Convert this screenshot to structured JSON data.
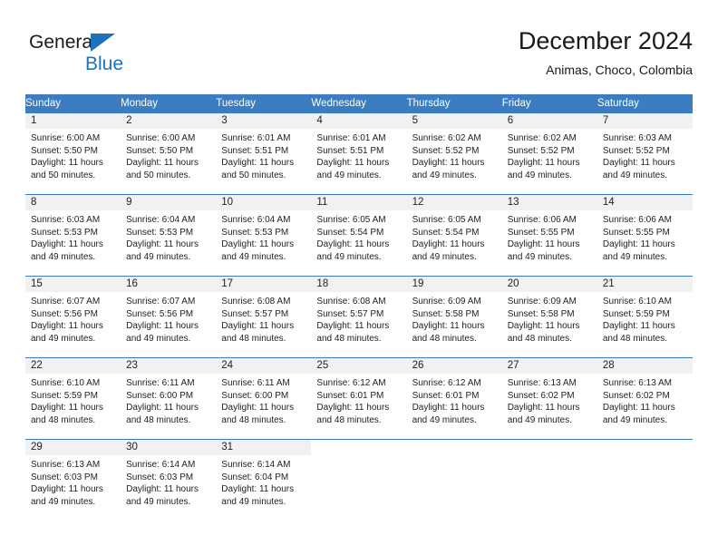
{
  "brand": {
    "name_part1": "General",
    "name_part2": "Blue",
    "triangle_icon": "triangle-logo-icon",
    "accent_color": "#1d72bc"
  },
  "header": {
    "title": "December 2024",
    "subtitle": "Animas, Choco, Colombia"
  },
  "calendar": {
    "header_bg": "#3b7dc0",
    "daynum_bg": "#f1f1f1",
    "weekdays": [
      "Sunday",
      "Monday",
      "Tuesday",
      "Wednesday",
      "Thursday",
      "Friday",
      "Saturday"
    ],
    "weeks": [
      [
        {
          "day": "1",
          "sunrise": "Sunrise: 6:00 AM",
          "sunset": "Sunset: 5:50 PM",
          "daylight1": "Daylight: 11 hours",
          "daylight2": "and 50 minutes."
        },
        {
          "day": "2",
          "sunrise": "Sunrise: 6:00 AM",
          "sunset": "Sunset: 5:50 PM",
          "daylight1": "Daylight: 11 hours",
          "daylight2": "and 50 minutes."
        },
        {
          "day": "3",
          "sunrise": "Sunrise: 6:01 AM",
          "sunset": "Sunset: 5:51 PM",
          "daylight1": "Daylight: 11 hours",
          "daylight2": "and 50 minutes."
        },
        {
          "day": "4",
          "sunrise": "Sunrise: 6:01 AM",
          "sunset": "Sunset: 5:51 PM",
          "daylight1": "Daylight: 11 hours",
          "daylight2": "and 49 minutes."
        },
        {
          "day": "5",
          "sunrise": "Sunrise: 6:02 AM",
          "sunset": "Sunset: 5:52 PM",
          "daylight1": "Daylight: 11 hours",
          "daylight2": "and 49 minutes."
        },
        {
          "day": "6",
          "sunrise": "Sunrise: 6:02 AM",
          "sunset": "Sunset: 5:52 PM",
          "daylight1": "Daylight: 11 hours",
          "daylight2": "and 49 minutes."
        },
        {
          "day": "7",
          "sunrise": "Sunrise: 6:03 AM",
          "sunset": "Sunset: 5:52 PM",
          "daylight1": "Daylight: 11 hours",
          "daylight2": "and 49 minutes."
        }
      ],
      [
        {
          "day": "8",
          "sunrise": "Sunrise: 6:03 AM",
          "sunset": "Sunset: 5:53 PM",
          "daylight1": "Daylight: 11 hours",
          "daylight2": "and 49 minutes."
        },
        {
          "day": "9",
          "sunrise": "Sunrise: 6:04 AM",
          "sunset": "Sunset: 5:53 PM",
          "daylight1": "Daylight: 11 hours",
          "daylight2": "and 49 minutes."
        },
        {
          "day": "10",
          "sunrise": "Sunrise: 6:04 AM",
          "sunset": "Sunset: 5:53 PM",
          "daylight1": "Daylight: 11 hours",
          "daylight2": "and 49 minutes."
        },
        {
          "day": "11",
          "sunrise": "Sunrise: 6:05 AM",
          "sunset": "Sunset: 5:54 PM",
          "daylight1": "Daylight: 11 hours",
          "daylight2": "and 49 minutes."
        },
        {
          "day": "12",
          "sunrise": "Sunrise: 6:05 AM",
          "sunset": "Sunset: 5:54 PM",
          "daylight1": "Daylight: 11 hours",
          "daylight2": "and 49 minutes."
        },
        {
          "day": "13",
          "sunrise": "Sunrise: 6:06 AM",
          "sunset": "Sunset: 5:55 PM",
          "daylight1": "Daylight: 11 hours",
          "daylight2": "and 49 minutes."
        },
        {
          "day": "14",
          "sunrise": "Sunrise: 6:06 AM",
          "sunset": "Sunset: 5:55 PM",
          "daylight1": "Daylight: 11 hours",
          "daylight2": "and 49 minutes."
        }
      ],
      [
        {
          "day": "15",
          "sunrise": "Sunrise: 6:07 AM",
          "sunset": "Sunset: 5:56 PM",
          "daylight1": "Daylight: 11 hours",
          "daylight2": "and 49 minutes."
        },
        {
          "day": "16",
          "sunrise": "Sunrise: 6:07 AM",
          "sunset": "Sunset: 5:56 PM",
          "daylight1": "Daylight: 11 hours",
          "daylight2": "and 49 minutes."
        },
        {
          "day": "17",
          "sunrise": "Sunrise: 6:08 AM",
          "sunset": "Sunset: 5:57 PM",
          "daylight1": "Daylight: 11 hours",
          "daylight2": "and 48 minutes."
        },
        {
          "day": "18",
          "sunrise": "Sunrise: 6:08 AM",
          "sunset": "Sunset: 5:57 PM",
          "daylight1": "Daylight: 11 hours",
          "daylight2": "and 48 minutes."
        },
        {
          "day": "19",
          "sunrise": "Sunrise: 6:09 AM",
          "sunset": "Sunset: 5:58 PM",
          "daylight1": "Daylight: 11 hours",
          "daylight2": "and 48 minutes."
        },
        {
          "day": "20",
          "sunrise": "Sunrise: 6:09 AM",
          "sunset": "Sunset: 5:58 PM",
          "daylight1": "Daylight: 11 hours",
          "daylight2": "and 48 minutes."
        },
        {
          "day": "21",
          "sunrise": "Sunrise: 6:10 AM",
          "sunset": "Sunset: 5:59 PM",
          "daylight1": "Daylight: 11 hours",
          "daylight2": "and 48 minutes."
        }
      ],
      [
        {
          "day": "22",
          "sunrise": "Sunrise: 6:10 AM",
          "sunset": "Sunset: 5:59 PM",
          "daylight1": "Daylight: 11 hours",
          "daylight2": "and 48 minutes."
        },
        {
          "day": "23",
          "sunrise": "Sunrise: 6:11 AM",
          "sunset": "Sunset: 6:00 PM",
          "daylight1": "Daylight: 11 hours",
          "daylight2": "and 48 minutes."
        },
        {
          "day": "24",
          "sunrise": "Sunrise: 6:11 AM",
          "sunset": "Sunset: 6:00 PM",
          "daylight1": "Daylight: 11 hours",
          "daylight2": "and 48 minutes."
        },
        {
          "day": "25",
          "sunrise": "Sunrise: 6:12 AM",
          "sunset": "Sunset: 6:01 PM",
          "daylight1": "Daylight: 11 hours",
          "daylight2": "and 48 minutes."
        },
        {
          "day": "26",
          "sunrise": "Sunrise: 6:12 AM",
          "sunset": "Sunset: 6:01 PM",
          "daylight1": "Daylight: 11 hours",
          "daylight2": "and 49 minutes."
        },
        {
          "day": "27",
          "sunrise": "Sunrise: 6:13 AM",
          "sunset": "Sunset: 6:02 PM",
          "daylight1": "Daylight: 11 hours",
          "daylight2": "and 49 minutes."
        },
        {
          "day": "28",
          "sunrise": "Sunrise: 6:13 AM",
          "sunset": "Sunset: 6:02 PM",
          "daylight1": "Daylight: 11 hours",
          "daylight2": "and 49 minutes."
        }
      ],
      [
        {
          "day": "29",
          "sunrise": "Sunrise: 6:13 AM",
          "sunset": "Sunset: 6:03 PM",
          "daylight1": "Daylight: 11 hours",
          "daylight2": "and 49 minutes."
        },
        {
          "day": "30",
          "sunrise": "Sunrise: 6:14 AM",
          "sunset": "Sunset: 6:03 PM",
          "daylight1": "Daylight: 11 hours",
          "daylight2": "and 49 minutes."
        },
        {
          "day": "31",
          "sunrise": "Sunrise: 6:14 AM",
          "sunset": "Sunset: 6:04 PM",
          "daylight1": "Daylight: 11 hours",
          "daylight2": "and 49 minutes."
        },
        {
          "day": "",
          "sunrise": "",
          "sunset": "",
          "daylight1": "",
          "daylight2": ""
        },
        {
          "day": "",
          "sunrise": "",
          "sunset": "",
          "daylight1": "",
          "daylight2": ""
        },
        {
          "day": "",
          "sunrise": "",
          "sunset": "",
          "daylight1": "",
          "daylight2": ""
        },
        {
          "day": "",
          "sunrise": "",
          "sunset": "",
          "daylight1": "",
          "daylight2": ""
        }
      ]
    ]
  }
}
